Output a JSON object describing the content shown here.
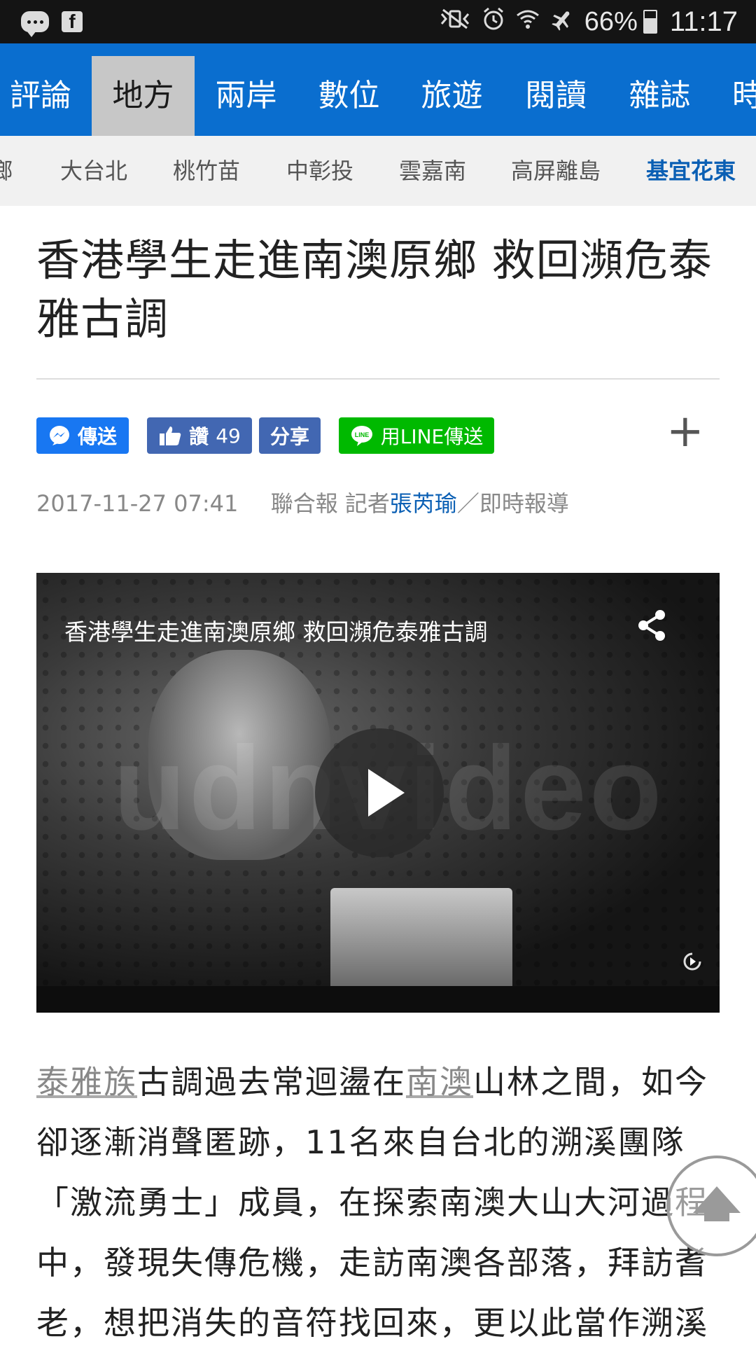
{
  "status_bar": {
    "battery": "66%",
    "time": "11:17"
  },
  "top_nav": {
    "tabs": [
      {
        "label": "評論"
      },
      {
        "label": "地方",
        "active": true
      },
      {
        "label": "兩岸"
      },
      {
        "label": "數位"
      },
      {
        "label": "旅遊"
      },
      {
        "label": "閱讀"
      },
      {
        "label": "雜誌"
      },
      {
        "label": "時"
      }
    ]
  },
  "sub_nav": {
    "items": [
      {
        "label": "鄉"
      },
      {
        "label": "大台北"
      },
      {
        "label": "桃竹苗"
      },
      {
        "label": "中彰投"
      },
      {
        "label": "雲嘉南"
      },
      {
        "label": "高屏離島"
      },
      {
        "label": "基宜花東",
        "active": true
      }
    ]
  },
  "article": {
    "headline": "香港學生走進南澳原鄉 救回瀕危泰雅古調",
    "share": {
      "messenger_label": "傳送",
      "like_label": "讚",
      "like_count": "49",
      "share_label": "分享",
      "line_label": "用LINE傳送",
      "more_label": "+"
    },
    "meta": {
      "datetime": "2017-11-27 07:41",
      "source": "聯合報 記者",
      "author": "張芮瑜",
      "suffix": "／即時報導"
    },
    "video": {
      "title": "香港學生走進南澳原鄉 救回瀕危泰雅古調",
      "watermark": "udnvideo"
    },
    "body": {
      "link1": "泰雅族",
      "text1": "古調過去常迴盪在",
      "link2": "南澳",
      "text2": "山林之間，如今卻逐漸消聲匿跡，11名來自台北的溯溪團隊「激流勇士」成員，在探索南澳大山大河過程中，發現失傳危機，走訪南澳各部落，拜訪耆老，想把消失的音符找回來，更以此當作溯溪"
    }
  },
  "colors": {
    "nav_blue": "#0a6ecf",
    "active_tab_bg": "#c7c7c7",
    "active_sub": "#0a5fb4",
    "messenger": "#1877f2",
    "facebook": "#4267b2",
    "line": "#00b900"
  }
}
